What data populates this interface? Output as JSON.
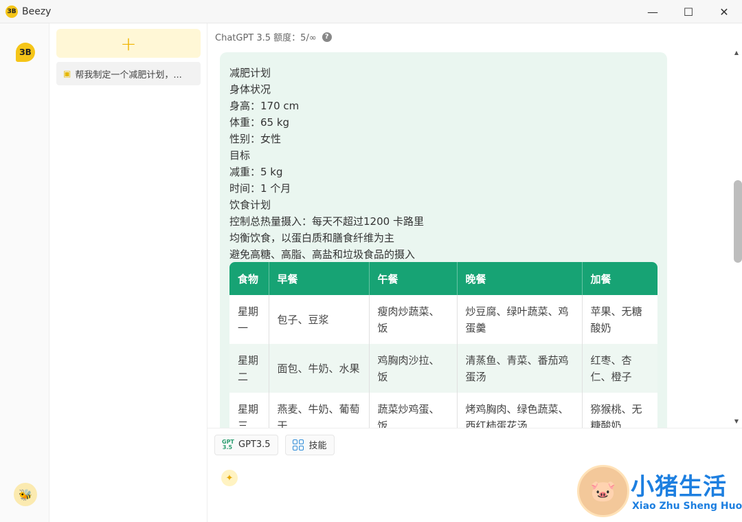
{
  "window": {
    "logo_text": "ЗB",
    "title": "Beezy",
    "minimize": "—",
    "maximize": "☐",
    "close": "✕"
  },
  "rail": {
    "logo_text": "ЗB",
    "avatar_icon": "bee-icon"
  },
  "sidebar": {
    "new_chat_label": "+",
    "conversations": [
      {
        "title": "帮我制定一个减肥计划，..."
      }
    ]
  },
  "header": {
    "quota_text": "ChatGPT 3.5 额度：5/∞",
    "help": "?"
  },
  "message": {
    "lines": [
      "减肥计划",
      "身体状况",
      "身高：170 cm",
      "体重：65 kg",
      "性别：女性",
      "目标",
      "减重：5 kg",
      "时间：1 个月",
      "饮食计划",
      "控制总热量摄入：每天不超过1200 卡路里",
      "均衡饮食，以蛋白质和膳食纤维为主",
      "避免高糖、高脂、高盐和垃圾食品的摄入"
    ],
    "table": {
      "headers": [
        "食物",
        "早餐",
        "午餐",
        "晚餐",
        "加餐"
      ],
      "rows": [
        [
          "星期一",
          "包子、豆浆",
          "瘦肉炒蔬菜、饭",
          "炒豆腐、绿叶蔬菜、鸡蛋羹",
          "苹果、无糖酸奶"
        ],
        [
          "星期二",
          "面包、牛奶、水果",
          "鸡胸肉沙拉、饭",
          "清蒸鱼、青菜、番茄鸡蛋汤",
          "红枣、杏仁、橙子"
        ],
        [
          "星期三",
          "燕麦、牛奶、葡萄干",
          "蔬菜炒鸡蛋、饭",
          "烤鸡胸肉、绿色蔬菜、西红柿蛋花汤",
          "猕猴桃、无糖酸奶"
        ]
      ]
    }
  },
  "toolbar": {
    "model_icon_text": "GPT 3.5",
    "model_label": "GPT3.5",
    "skills_label": "技能"
  },
  "input": {
    "placeholder": ""
  },
  "watermark": {
    "title": "小猪生活",
    "subtitle": "Xiao Zhu Sheng Huo"
  },
  "colors": {
    "accent": "#f5c518",
    "table_header": "#17a374",
    "bubble_bg": "#eaf6f0"
  }
}
